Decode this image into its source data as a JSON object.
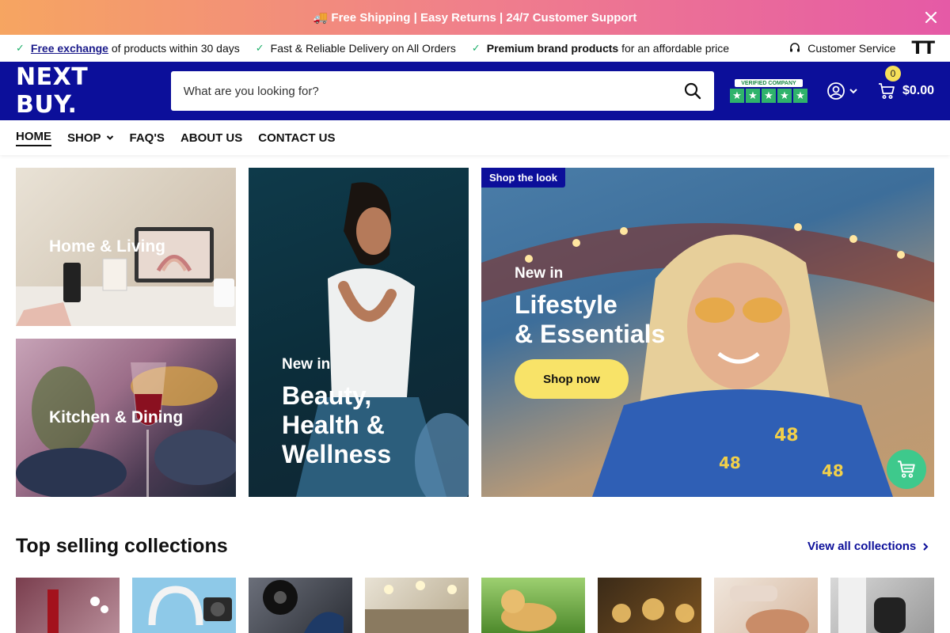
{
  "announcement": {
    "text": "🚚 Free Shipping | Easy Returns | 24/7 Customer Support",
    "close_icon": "close-icon"
  },
  "usp": {
    "items": [
      {
        "link": "Free exchange",
        "text": " of products within 30 days"
      },
      {
        "text": "Fast & Reliable Delivery on All Orders"
      },
      {
        "strong": "Premium brand products",
        "text": " for an affordable price"
      }
    ],
    "customer_service": "Customer Service",
    "text_size_icon": "TT"
  },
  "header": {
    "logo": "NEXT BUY.",
    "search_placeholder": "What are you looking for?",
    "trust_badge": "VERIFIED COMPANY",
    "cart_count": "0",
    "cart_total": "$0.00"
  },
  "nav": {
    "home": "HOME",
    "shop": "SHOP",
    "faqs": "FAQ'S",
    "about": "ABOUT US",
    "contact": "CONTACT US"
  },
  "tiles": {
    "home_living": "Home & Living",
    "kitchen_dining": "Kitchen & Dining",
    "beauty_kicker": "New in",
    "beauty_title_1": "Beauty,",
    "beauty_title_2": "Health &",
    "beauty_title_3": "Wellness",
    "look_tag": "Shop the look",
    "lifestyle_kicker": "New in",
    "lifestyle_title_1": "Lifestyle",
    "lifestyle_title_2": "& Essentials",
    "shop_now": "Shop now"
  },
  "collections": {
    "title": "Top selling collections",
    "view_all": "View all collections"
  },
  "colors": {
    "brand_blue": "#0c0f9a",
    "accent_yellow": "#f8e368",
    "accent_green": "#3ec98c"
  }
}
